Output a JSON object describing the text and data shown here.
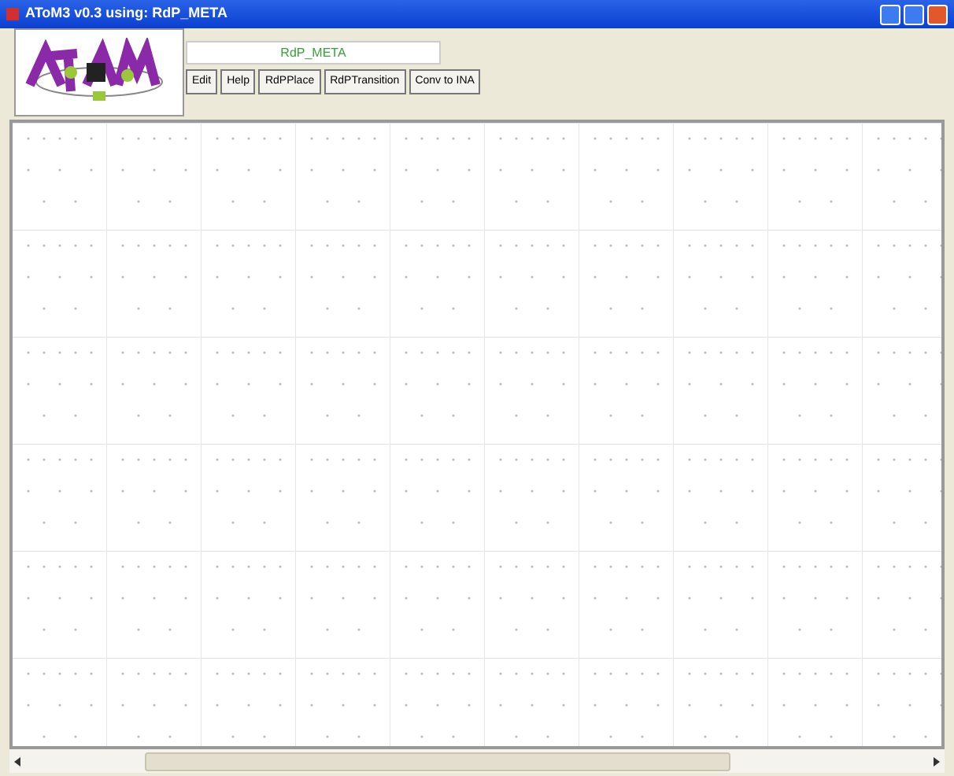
{
  "window": {
    "title": "AToM3 v0.3 using: RdP_META"
  },
  "formalism": {
    "label": "RdP_META"
  },
  "buttons": [
    "Edit",
    "Help",
    "RdPPlace",
    "RdPTransition",
    "Conv to INA"
  ]
}
